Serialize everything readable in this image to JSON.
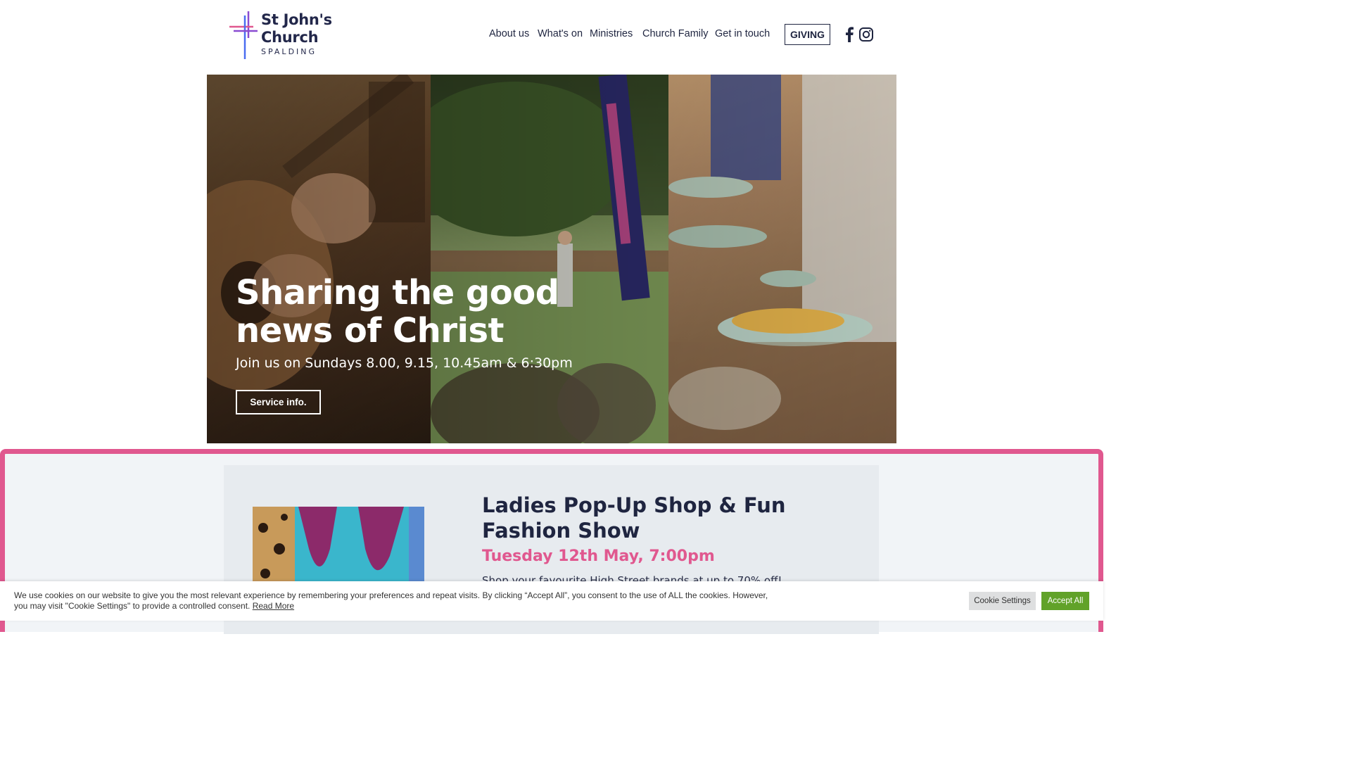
{
  "header": {
    "logo": {
      "line1": "St John's",
      "line2": "Church",
      "line3": "SPALDING"
    },
    "nav": [
      {
        "label": "About us"
      },
      {
        "label": "What's on"
      },
      {
        "label": "Ministries"
      },
      {
        "label": "Church Family"
      },
      {
        "label": "Get in touch"
      }
    ],
    "giving_label": "GIVING",
    "social": [
      "facebook-icon",
      "instagram-icon"
    ]
  },
  "hero": {
    "title_line1": "Sharing the good",
    "title_line2": "news of Christ",
    "subtitle": "Join us on Sundays 8.00, 9.15, 10.45am & 6:30pm",
    "button_label": "Service info."
  },
  "event": {
    "title": "Ladies Pop-Up Shop & Fun Fashion Show",
    "date": "Tuesday 12th May, 7:00pm",
    "description": "Shop your favourite High Street brands at up to 70% off!"
  },
  "cookie": {
    "text": "We use cookies on our website to give you the most relevant experience by remembering your preferences and repeat visits. By clicking “Accept All”, you consent to the use of ALL the cookies. However, you may visit \"Cookie Settings\" to provide a controlled consent.",
    "read_more": "Read More",
    "settings_label": "Cookie Settings",
    "accept_label": "Accept All"
  },
  "colors": {
    "navy": "#1f2540",
    "pink": "#e0588f",
    "accept_green": "#61a229",
    "logo_pink": "#e0588f",
    "logo_blue": "#4a6cf0",
    "logo_purple": "#8a4bd1"
  }
}
